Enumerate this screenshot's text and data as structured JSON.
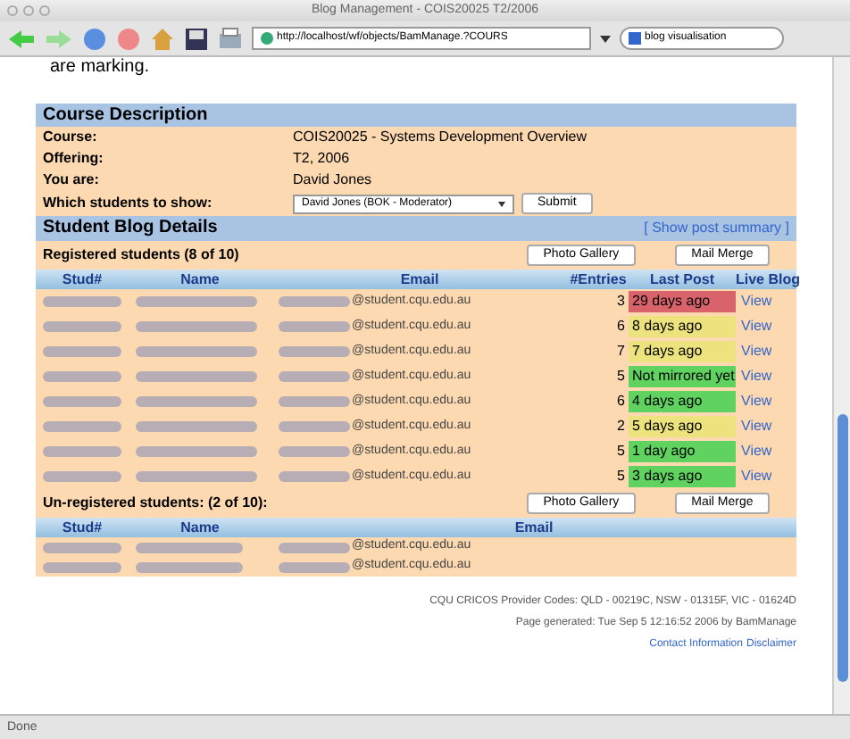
{
  "window": {
    "title": "Blog Management - COIS20025 T2/2006"
  },
  "toolbar": {
    "url": "http://localhost/wf/objects/BamManage.?COURS",
    "search": "blog visualisation"
  },
  "intro": "are marking.",
  "course": {
    "heading": "Course Description",
    "fields": [
      {
        "label": "Course:",
        "value": "COIS20025 - Systems Development Overview"
      },
      {
        "label": "Offering:",
        "value": "T2, 2006"
      },
      {
        "label": "You are:",
        "value": "David Jones"
      }
    ],
    "filter": {
      "label": "Which students to show:",
      "value": "David Jones (BOK - Moderator)",
      "button": "Submit"
    }
  },
  "blog": {
    "heading": "Student Blog Details",
    "summary_link": "[ Show post summary ]",
    "registered": {
      "title": "Registered students (8 of 10)",
      "buttons": [
        "Photo Gallery",
        "Mail Merge"
      ],
      "columns": [
        "Stud#",
        "Name",
        "Email",
        "#Entries",
        "Last Post",
        "Live Blog"
      ],
      "rows": [
        {
          "email": "@student.cqu.edu.au",
          "entries": "3",
          "last_post": "29 days ago",
          "color": "#d9636b",
          "live": "View"
        },
        {
          "email": "@student.cqu.edu.au",
          "entries": "6",
          "last_post": "8 days ago",
          "color": "#ece27e",
          "live": "View"
        },
        {
          "email": "@student.cqu.edu.au",
          "entries": "7",
          "last_post": "7 days ago",
          "color": "#ece27e",
          "live": "View"
        },
        {
          "email": "@student.cqu.edu.au",
          "entries": "5",
          "last_post": "Not mirrored yet",
          "color": "#5fd25f",
          "live": "View"
        },
        {
          "email": "@student.cqu.edu.au",
          "entries": "6",
          "last_post": "4 days ago",
          "color": "#5fd25f",
          "live": "View"
        },
        {
          "email": "@student.cqu.edu.au",
          "entries": "2",
          "last_post": "5 days ago",
          "color": "#ece27e",
          "live": "View"
        },
        {
          "email": "@student.cqu.edu.au",
          "entries": "5",
          "last_post": "1 day ago",
          "color": "#5fd25f",
          "live": "View"
        },
        {
          "email": "@student.cqu.edu.au",
          "entries": "5",
          "last_post": "3 days ago",
          "color": "#5fd25f",
          "live": "View"
        }
      ]
    },
    "unregistered": {
      "title": "Un-registered students: (2 of 10):",
      "buttons": [
        "Photo Gallery",
        "Mail Merge"
      ],
      "columns": [
        "Stud#",
        "Name",
        "Email"
      ],
      "rows": [
        {
          "email": "@student.cqu.edu.au"
        },
        {
          "email": "@student.cqu.edu.au"
        }
      ]
    }
  },
  "footer": {
    "lines": [
      "CQU CRICOS Provider Codes: QLD - 00219C, NSW - 01315F, VIC - 01624D",
      "Page generated: Tue Sep 5 12:16:52 2006 by BamManage"
    ],
    "links": [
      "Contact Information",
      "Disclaimer"
    ]
  },
  "status_bar": "Done"
}
